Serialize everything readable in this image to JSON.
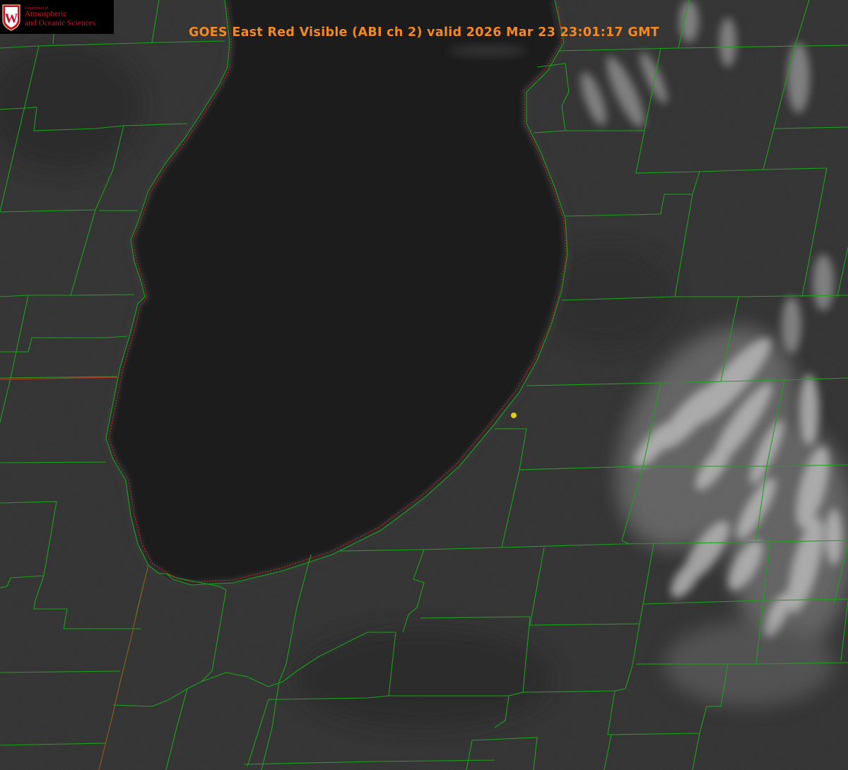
{
  "title": "GOES East Red Visible (ABI ch 2) valid 2026 Mar 23 23:01:17 GMT",
  "logo": {
    "department_line": "Department of",
    "line1": "Atmospheric",
    "line2": "and Oceanic Sciences",
    "seal_letter": "W"
  },
  "colors": {
    "land": "#2e2e2e",
    "lake": "#1c1c1c",
    "county_lines": "#1aa31a",
    "shoreline_dotted": "#e02020",
    "state_line": "#c0301c",
    "title": "#f5891f",
    "marker": "#d8d020",
    "logo_red": "#c8102e"
  },
  "map": {
    "features": [
      "land",
      "lake",
      "clouds",
      "county-boundaries",
      "shoreline",
      "state-boundary",
      "location-marker"
    ]
  }
}
